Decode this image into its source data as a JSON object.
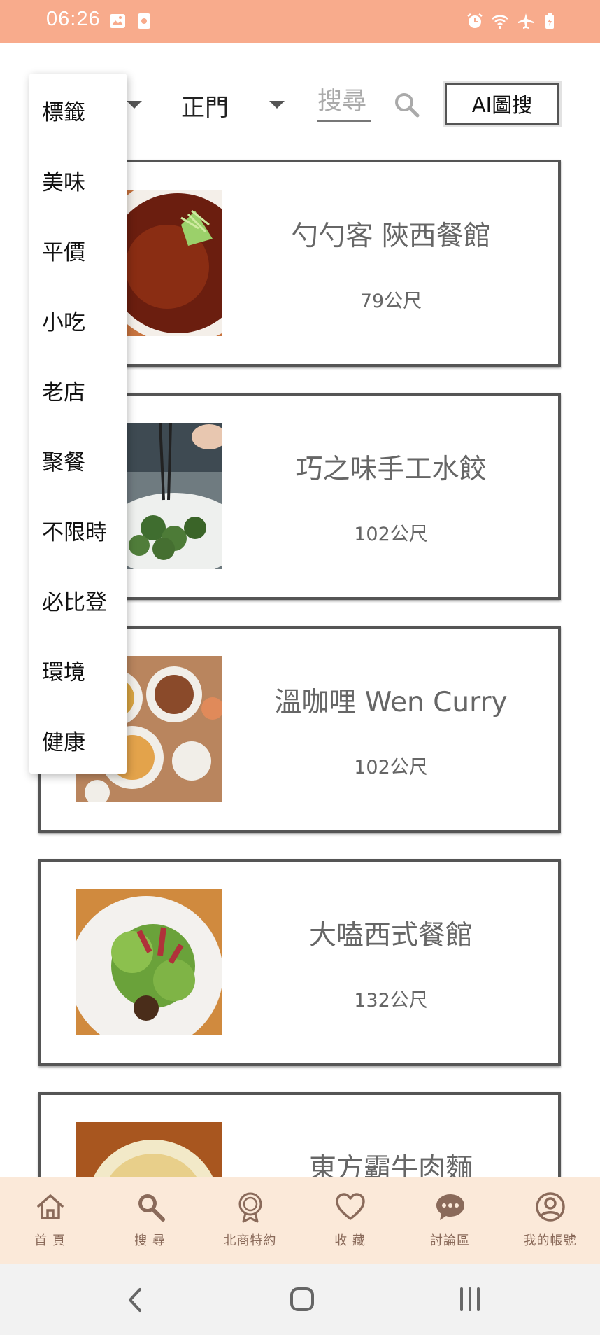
{
  "status_bar": {
    "time": "06:26"
  },
  "top_bar": {
    "area_select": "正門",
    "search_placeholder": "搜尋",
    "ai_search_label": "AI圖搜"
  },
  "tag_dropdown": {
    "items": [
      "標籤",
      "美味",
      "平價",
      "小吃",
      "老店",
      "聚餐",
      "不限時",
      "必比登",
      "環境",
      "健康"
    ]
  },
  "restaurants": [
    {
      "name": "勺勺客 陝西餐館",
      "distance": "79公尺"
    },
    {
      "name": "巧之味手工水餃",
      "distance": "102公尺"
    },
    {
      "name": "溫咖哩 Wen Curry",
      "distance": "102公尺"
    },
    {
      "name": "大嗑西式餐館",
      "distance": "132公尺"
    },
    {
      "name": "東方霸牛肉麵",
      "distance": ""
    }
  ],
  "bottom_nav": {
    "items": [
      {
        "label": "首 頁",
        "icon": "home-icon"
      },
      {
        "label": "搜 尋",
        "icon": "search-icon"
      },
      {
        "label": "北商特約",
        "icon": "badge-icon"
      },
      {
        "label": "收 藏",
        "icon": "heart-icon"
      },
      {
        "label": "討論區",
        "icon": "chat-icon"
      },
      {
        "label": "我的帳號",
        "icon": "account-icon"
      }
    ]
  },
  "colors": {
    "status_bar": "#f8ab8c",
    "bottom_nav_bg": "#fbe9d9",
    "nav_icon": "#8a6a5a"
  }
}
